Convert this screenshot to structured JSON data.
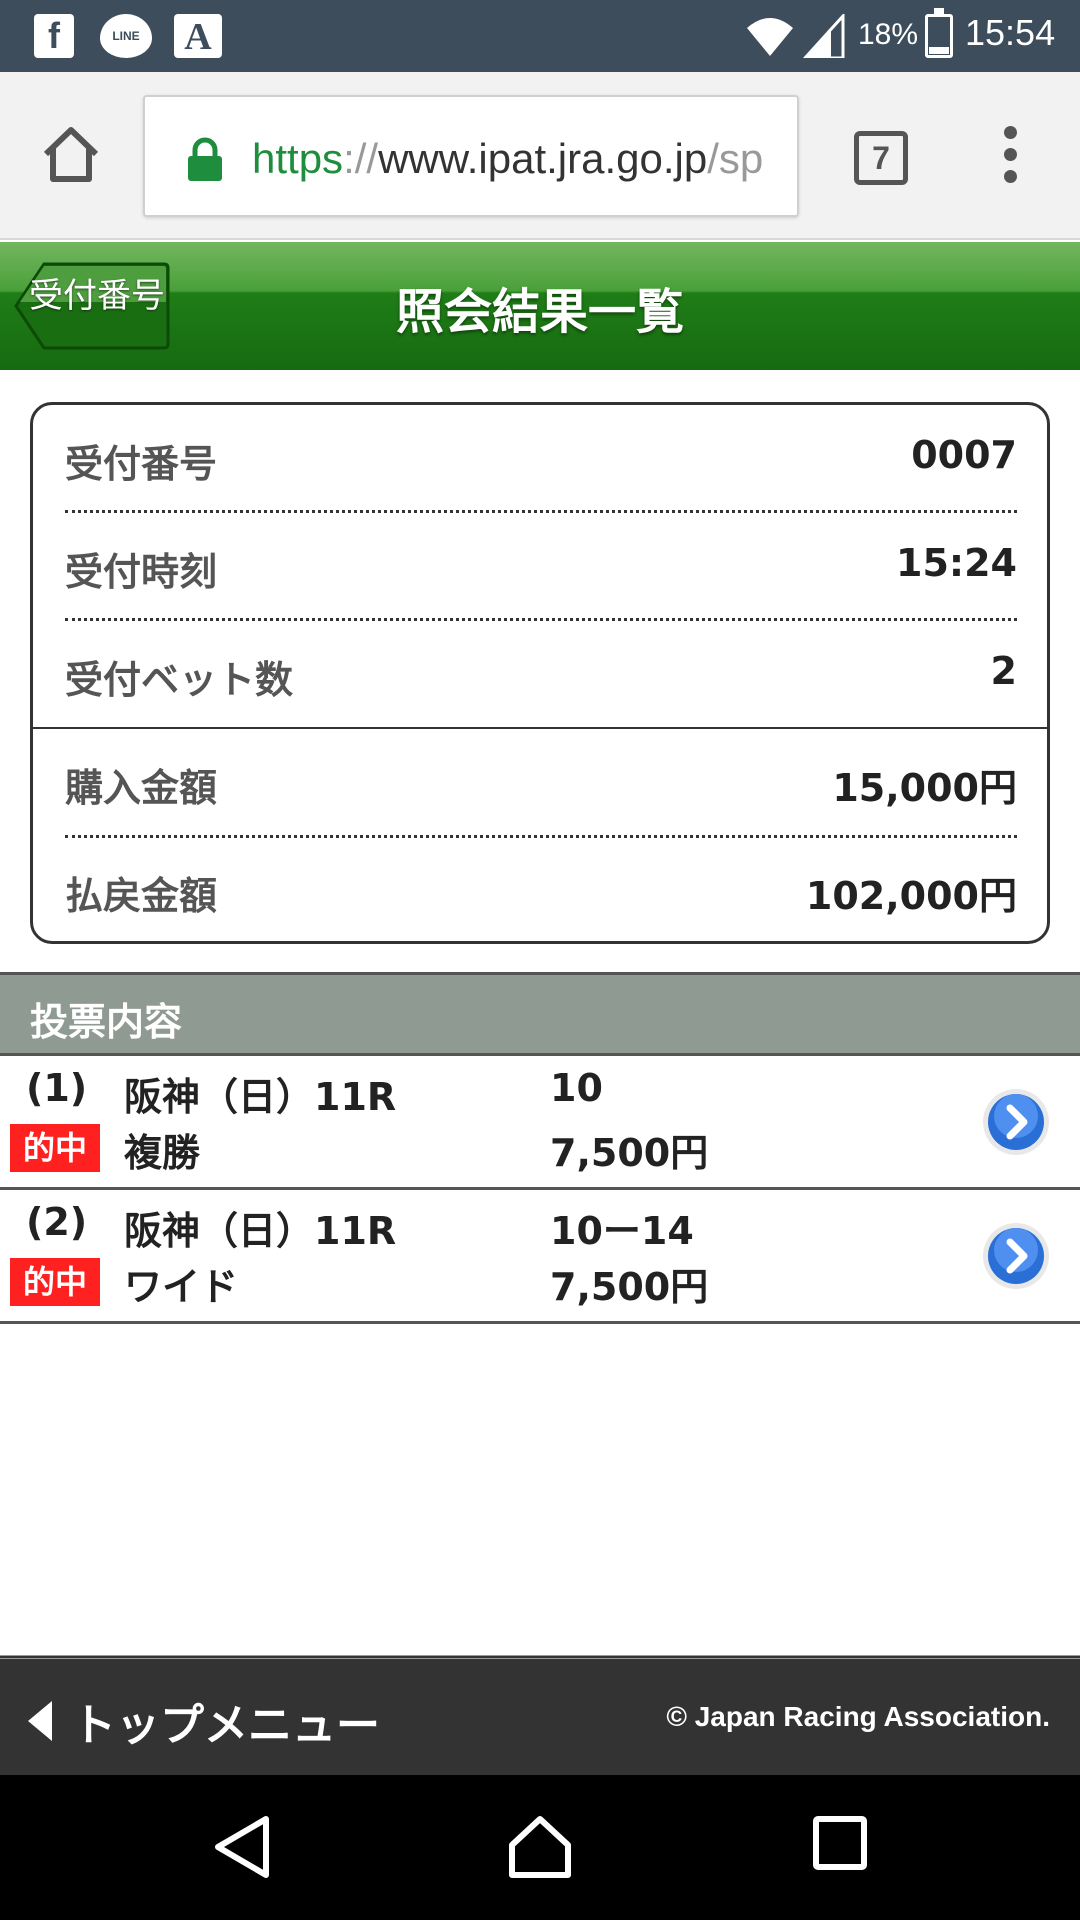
{
  "status_bar": {
    "icons": [
      "facebook-icon",
      "line-icon",
      "a-icon",
      "wifi-icon",
      "signal-icon",
      "battery-icon"
    ],
    "fb_glyph": "f",
    "line_glyph": "LINE",
    "a_glyph": "A",
    "battery": "18%",
    "time": "15:54"
  },
  "browser": {
    "url_scheme": "https",
    "url_sep": "://",
    "url_host": "www.ipat.jra.go.jp",
    "url_tail": "/sp",
    "tab_count": "7"
  },
  "header": {
    "back_label": "受付番号",
    "title": "照会結果一覧",
    "colors": {
      "header_green": "#1f7d17",
      "badge_red": "#ff2020"
    }
  },
  "summary": {
    "receipt_no_label": "受付番号",
    "receipt_no": "0007",
    "receipt_time_label": "受付時刻",
    "receipt_time": "15:24",
    "bet_count_label": "受付ベット数",
    "bet_count": "2",
    "purchase_label": "購入金額",
    "purchase": "15,000円",
    "payout_label": "払戻金額",
    "payout": "102,000円"
  },
  "votes": {
    "section_title": "投票内容",
    "items": [
      {
        "num": "(1)",
        "race": "阪神（日）11R",
        "horses": "10",
        "badge": "的中",
        "type": "複勝",
        "amount": "7,500円"
      },
      {
        "num": "(2)",
        "race": "阪神（日）11R",
        "horses": "10ー14",
        "badge": "的中",
        "type": "ワイド",
        "amount": "7,500円"
      }
    ]
  },
  "footer": {
    "top_menu": "トップメニュー",
    "copyright": "© Japan Racing Association."
  }
}
